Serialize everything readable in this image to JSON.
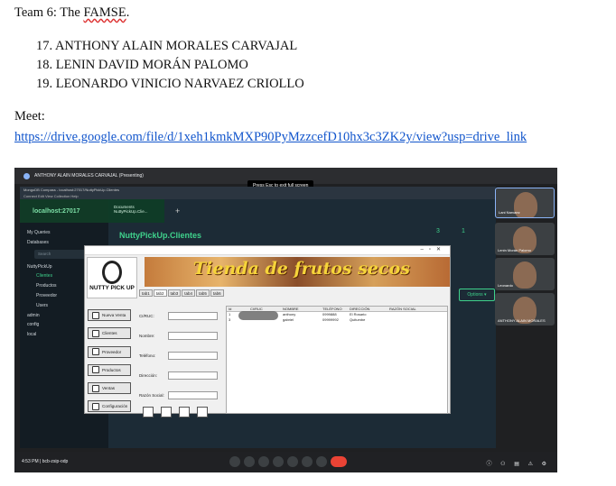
{
  "doc": {
    "team_prefix": "Team 6: The ",
    "team_name": "FAMSE",
    "team_suffix": ".",
    "members": [
      "17. ANTHONY ALAIN MORALES CARVAJAL",
      "18. LENIN DAVID MORÁN PALOMO",
      "19. LEONARDO VINICIO NARVAEZ CRIOLLO"
    ],
    "meet_label": "Meet:",
    "link": "https://drive.google.com/file/d/1xeh1kmkMXP90PyMzzcefD10hx3c3ZK2y/view?usp=drive_link"
  },
  "screenshot": {
    "presenting_bar": "ANTHONY ALAIN MORALES CARVAJAL (Presenting)",
    "esc_hint": "Press Esc to exit full screen",
    "compass": {
      "window_title": "MongoDB Compass - localhost:27017/NuttyPickUp.Clientes",
      "menu": "Connect  Edit  View  Collection  Help",
      "connection": "localhost:27017",
      "conn_tab_line1": "Documents",
      "conn_tab_line2": "NuttyPickUp.Clie...",
      "plus": "+",
      "side_items": [
        "My Queries",
        "Databases",
        "NuttyPickUp",
        "Clientes",
        "Productos",
        "Proveedor",
        "Users",
        "admin",
        "config",
        "local"
      ],
      "search_placeholder": "Search",
      "collection_title": "NuttyPickUp.Clientes",
      "stats": [
        "3",
        "1"
      ],
      "options_button": "Options ▾",
      "mongosh": ">_MONGOSH",
      "share_banner": "meet.google.com está compartiendo tu pantalla.",
      "stop_share": "Dejar de compartir",
      "hide": "Ocultar"
    },
    "app": {
      "logo_text": "NUTTY PICK UP",
      "banner_text": "Tienda de frutos secos",
      "tabs": [
        "tab1",
        "tab2",
        "tab3",
        "tab4",
        "tab5",
        "tab6"
      ],
      "nav_buttons": [
        "Nueva Venta",
        "Clientes",
        "Proveedor",
        "Productos",
        "Ventas",
        "Configuración"
      ],
      "form_labels": [
        "CI/RUC:",
        "Nombre:",
        "Teléfono:",
        "Dirección:",
        "Razón Social:"
      ],
      "grid_headers": [
        "Id",
        "CI/RUC",
        "NOMBRE",
        "TELÉFONO",
        "DIRECCIÓN",
        "RAZÓN SOCIAL"
      ],
      "grid_rows": [
        [
          "1",
          "",
          "anthony",
          "0999888",
          "El Rosario",
          ""
        ],
        [
          "3",
          "",
          "gabriel",
          "09999992",
          "Quitumbe",
          ""
        ]
      ]
    },
    "participants": [
      "Lani Narvaez",
      "Lenin Morán Palomo",
      "Leonardo",
      "ANTHONY ALAIN MORALES"
    ],
    "meet_bar": {
      "time": "4:53 PM  |  bcb-zsip-odp"
    }
  }
}
